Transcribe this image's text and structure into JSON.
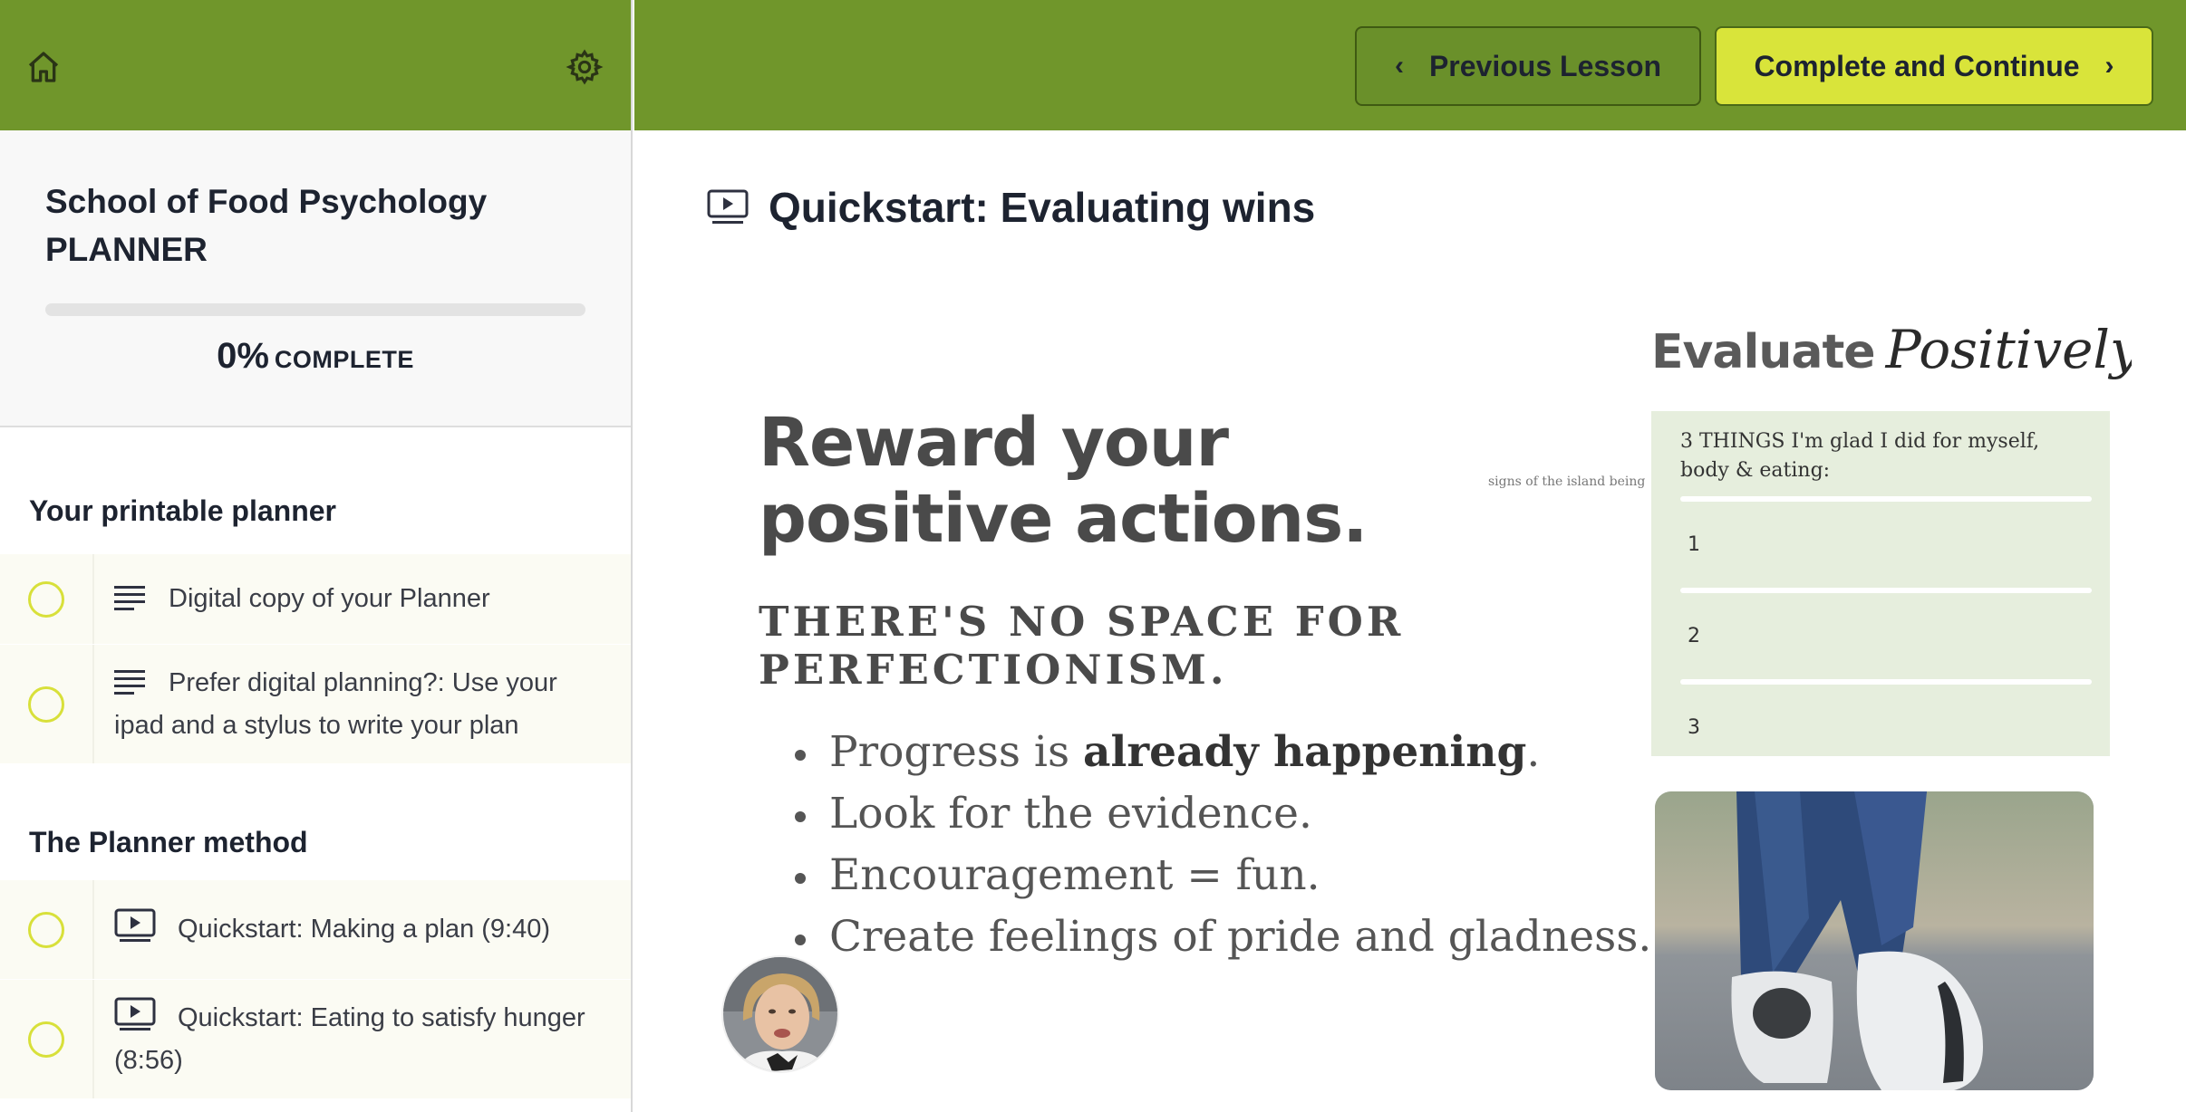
{
  "sidebar": {
    "course_title": "School of Food Psychology PLANNER",
    "progress": {
      "percent_text": "0%",
      "label": "COMPLETE",
      "value": 0
    },
    "sections": [
      {
        "title": "Your printable planner",
        "lessons": [
          {
            "icon": "text-lines-icon",
            "label": "Digital copy of your Planner"
          },
          {
            "icon": "text-lines-icon",
            "label": "Prefer digital planning?: Use your ipad and a stylus to write your plan"
          }
        ]
      },
      {
        "title": "The Planner method",
        "lessons": [
          {
            "icon": "video-icon",
            "label": "Quickstart: Making a plan (9:40)"
          },
          {
            "icon": "video-icon",
            "label": "Quickstart: Eating to satisfy hunger (8:56)"
          }
        ]
      }
    ]
  },
  "topbar": {
    "previous_label": "Previous Lesson",
    "next_label": "Complete and Continue"
  },
  "lesson": {
    "title": "Quickstart: Evaluating wins"
  },
  "slide": {
    "heading": "Reward your positive actions.",
    "faded_text": "signs of the island being",
    "subheading": "THERE'S NO SPACE FOR PERFECTIONISM.",
    "bullets": [
      {
        "pre": "Progress is ",
        "bold": "already happening",
        "post": "."
      },
      {
        "pre": "Look for the evidence.",
        "bold": "",
        "post": ""
      },
      {
        "pre": "Encouragement = fun.",
        "bold": "",
        "post": ""
      },
      {
        "pre": "Create feelings of pride and gladness.",
        "bold": "",
        "post": ""
      }
    ],
    "eval_title_a": "Evaluate",
    "eval_title_b": "Positively",
    "card_heading": "3 THINGS I'm glad I did for myself, body & eating:",
    "card_numbers": [
      "1",
      "2",
      "3"
    ]
  },
  "colors": {
    "brand_green": "#70962b",
    "accent_yellow": "#d9e43a",
    "card_green": "#e6eedd"
  }
}
